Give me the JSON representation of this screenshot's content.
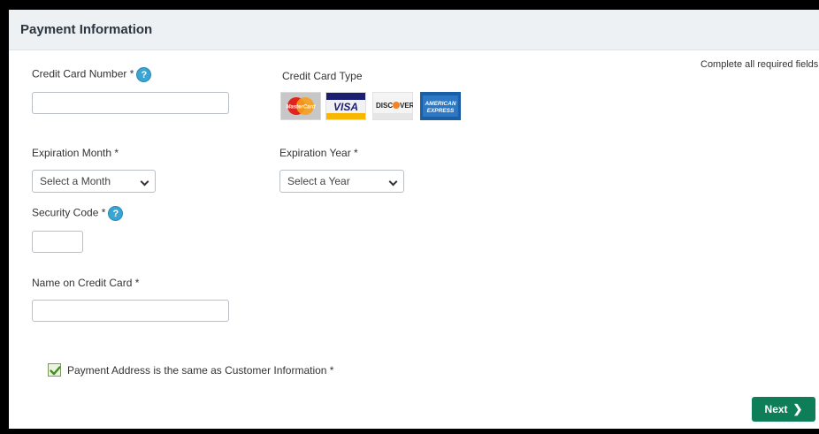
{
  "header": {
    "title": "Payment Information"
  },
  "required_note": "Complete all required fields [ *",
  "credit_card_number": {
    "label": "Credit Card Number *",
    "value": ""
  },
  "credit_card_type": {
    "label": "Credit Card Type",
    "cards": [
      "mastercard-icon",
      "visa-icon",
      "discover-icon",
      "american-express-icon"
    ]
  },
  "expiration_month": {
    "label": "Expiration Month *",
    "selected": "Select a Month"
  },
  "expiration_year": {
    "label": "Expiration Year *",
    "selected": "Select a Year"
  },
  "security_code": {
    "label": "Security Code *",
    "value": ""
  },
  "name_on_card": {
    "label": "Name on Credit Card *",
    "value": ""
  },
  "payment_address_same": {
    "label": "Payment Address is the same as Customer Information *",
    "checked": true
  },
  "next_button": {
    "label": "Next"
  },
  "colors": {
    "accent": "#0e7e58",
    "help": "#3aa5d2",
    "header_bg": "#eef1f4"
  }
}
